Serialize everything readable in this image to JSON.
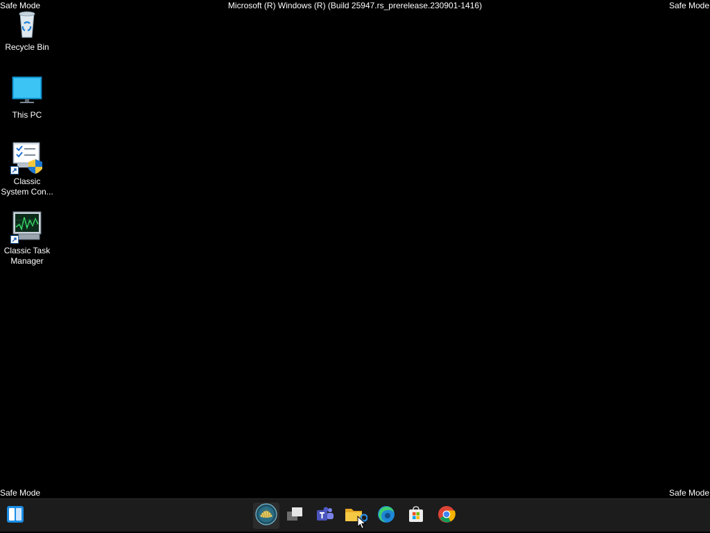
{
  "watermarks": {
    "top_left": "Safe Mode",
    "top_right": "Safe Mode",
    "bottom_left": "Safe Mode",
    "bottom_right": "Safe Mode"
  },
  "build_text": "Microsoft (R) Windows (R) (Build 25947.rs_prerelease.230901-1416)",
  "desktop_icons": [
    {
      "label": "Recycle Bin",
      "icon": "recycle-bin-icon"
    },
    {
      "label": "This PC",
      "icon": "monitor-icon"
    },
    {
      "label_lines": [
        "Classic",
        "System Con..."
      ],
      "icon": "system-config-icon"
    },
    {
      "label_lines": [
        "Classic Task",
        "Manager"
      ],
      "icon": "task-manager-icon"
    }
  ],
  "taskbar": {
    "items": [
      {
        "name": "widgets",
        "icon": "widgets-icon"
      },
      {
        "name": "start",
        "icon": "start-shell-icon"
      },
      {
        "name": "task-view",
        "icon": "task-view-icon"
      },
      {
        "name": "teams",
        "icon": "teams-icon",
        "text": "T"
      },
      {
        "name": "file-explorer",
        "icon": "folder-icon"
      },
      {
        "name": "edge",
        "icon": "edge-icon"
      },
      {
        "name": "store",
        "icon": "store-icon"
      },
      {
        "name": "chrome",
        "icon": "chrome-icon"
      }
    ]
  },
  "colors": {
    "desktop_bg": "#000000",
    "taskbar_bg": "#1c1c1c",
    "accent_blue": "#0078d4",
    "folder_yellow": "#f2b731"
  }
}
